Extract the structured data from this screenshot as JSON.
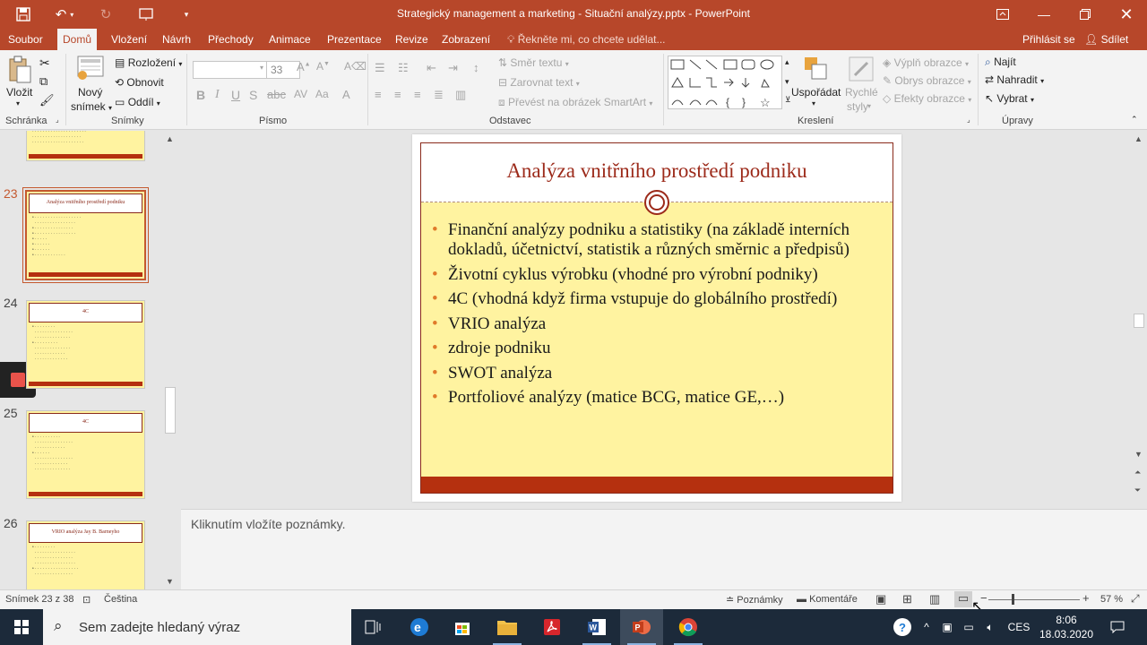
{
  "window": {
    "title": "Strategický management a marketing - Situační analýzy.pptx - PowerPoint"
  },
  "ribbon_tabs": [
    "Soubor",
    "Domů",
    "Vložení",
    "Návrh",
    "Přechody",
    "Animace",
    "Prezentace",
    "Revize",
    "Zobrazení"
  ],
  "tell_me": "Řekněte mi, co chcete udělat...",
  "sign_in": "Přihlásit se",
  "share": "Sdílet",
  "ribbon": {
    "paste": "Vložit",
    "clipboard_group": "Schránka",
    "new_slide_line1": "Nový",
    "new_slide_line2": "snímek",
    "layout": "Rozložení",
    "reset": "Obnovit",
    "section": "Oddíl",
    "slides_group": "Snímky",
    "font_size": "33",
    "font_group": "Písmo",
    "text_direction": "Směr textu",
    "align_text": "Zarovnat text",
    "smartart": "Převést na obrázek SmartArt",
    "paragraph_group": "Odstavec",
    "arrange": "Uspořádat",
    "quick_styles_line1": "Rychlé",
    "quick_styles_line2": "styly",
    "shape_fill": "Výplň obrazce",
    "shape_outline": "Obrys obrazce",
    "shape_effects": "Efekty obrazce",
    "drawing_group": "Kreslení",
    "find": "Najít",
    "replace": "Nahradit",
    "select": "Vybrat",
    "editing_group": "Úpravy"
  },
  "thumbnails": [
    {
      "number": "23",
      "title": "Analýza vnitřního prostředí podniku",
      "selected": true
    },
    {
      "number": "24",
      "title": "4C",
      "selected": false
    },
    {
      "number": "25",
      "title": "4C",
      "selected": false
    },
    {
      "number": "26",
      "title": "VRIO analýza Jay B. Barneyho",
      "selected": false
    }
  ],
  "slide": {
    "title": "Analýza vnitřního prostředí podniku",
    "bullets": [
      "Finanční analýzy podniku a statistiky (na základě interních dokladů, účetnictví, statistik a různých směrnic a předpisů)",
      "Životní cyklus výrobku (vhodné pro výrobní podniky)",
      "4C (vhodná když firma vstupuje do globálního prostředí)",
      "VRIO analýza",
      "zdroje podniku",
      "SWOT analýza",
      "Portfoliové analýzy (matice BCG, matice GE,…)"
    ]
  },
  "notes_placeholder": "Kliknutím vložíte poznámky.",
  "status": {
    "slide_counter": "Snímek 23 z 38",
    "language": "Čeština",
    "notes": "Poznámky",
    "comments": "Komentáře",
    "zoom": "57 %",
    "zoom_fraction": 0.57
  },
  "taskbar": {
    "search_placeholder": "Sem zadejte hledaný výraz",
    "input_language": "CES",
    "time": "8:06",
    "date": "18.03.2020"
  },
  "colors": {
    "accent": "#b7472a",
    "slide_title": "#9c2a1a",
    "slide_background": "#fff3a0",
    "bullet": "#e07a2a"
  }
}
